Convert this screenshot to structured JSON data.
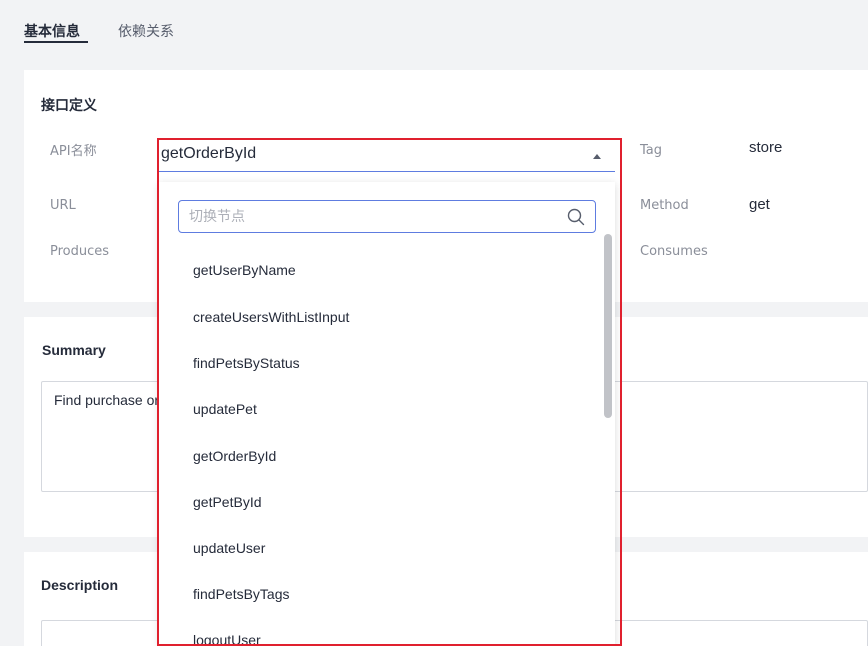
{
  "tabs": [
    {
      "label": "基本信息",
      "active": true
    },
    {
      "label": "依赖关系",
      "active": false
    }
  ],
  "definition": {
    "title": "接口定义",
    "api_name_label": "API名称",
    "url_label": "URL",
    "produces_label": "Produces",
    "tag_label": "Tag",
    "tag_value": "store",
    "method_label": "Method",
    "method_value": "get",
    "consumes_label": "Consumes"
  },
  "select": {
    "value": "getOrderById"
  },
  "dropdown": {
    "search_placeholder": "切换节点",
    "options": [
      "getUserByName",
      "createUsersWithListInput",
      "findPetsByStatus",
      "updatePet",
      "getOrderById",
      "getPetById",
      "updateUser",
      "findPetsByTags",
      "logoutUser"
    ]
  },
  "summary": {
    "title": "Summary",
    "text": "Find purchase order by ID"
  },
  "description": {
    "title": "Description"
  },
  "colors": {
    "accent": "#5e7ce0",
    "highlight": "#e0202e"
  }
}
